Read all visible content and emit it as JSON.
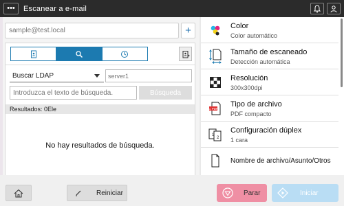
{
  "header": {
    "title": "Escanear a e-mail",
    "menu_glyph": "•••",
    "icons": [
      "bell-icon",
      "user-icon"
    ]
  },
  "left": {
    "email_placeholder": "sample@test.local",
    "add_label": "+",
    "tabs": [
      {
        "name": "address-book",
        "icon": "address-book-icon",
        "active": false
      },
      {
        "name": "search",
        "icon": "search-icon",
        "active": true
      },
      {
        "name": "history",
        "icon": "clock-icon",
        "active": false
      }
    ],
    "search_type": "Buscar  LDAP",
    "server_placeholder": "server1",
    "query_placeholder": "Introduzca el texto de búsqueda.",
    "search_button": "Búsqueda",
    "results_label": "Resultados: 0Ele",
    "empty_message": "No hay resultados de búsqueda."
  },
  "settings": [
    {
      "name": "Color",
      "value": "Color automático",
      "icon": "color-icon"
    },
    {
      "name": "Tamaño de escaneado",
      "value": "Detección automática",
      "icon": "scan-size-icon"
    },
    {
      "name": "Resolución",
      "value": "300x300dpi",
      "icon": "resolution-icon"
    },
    {
      "name": "Tipo de archivo",
      "value": "PDF compacto",
      "icon": "pdf-icon"
    },
    {
      "name": "Configuración dúplex",
      "value": "1 cara",
      "icon": "duplex-icon"
    },
    {
      "name": "Nombre de archivo/Asunto/Otros",
      "value": "",
      "icon": "document-icon"
    }
  ],
  "bottom": {
    "reset_label": "Reiniciar",
    "stop_label": "Parar",
    "start_label": "Iniciar"
  },
  "colors": {
    "accent": "#1c7ab0",
    "stop": "#ef8fa4",
    "start": "#b9ddf4",
    "topbar": "#2b2b2b"
  }
}
